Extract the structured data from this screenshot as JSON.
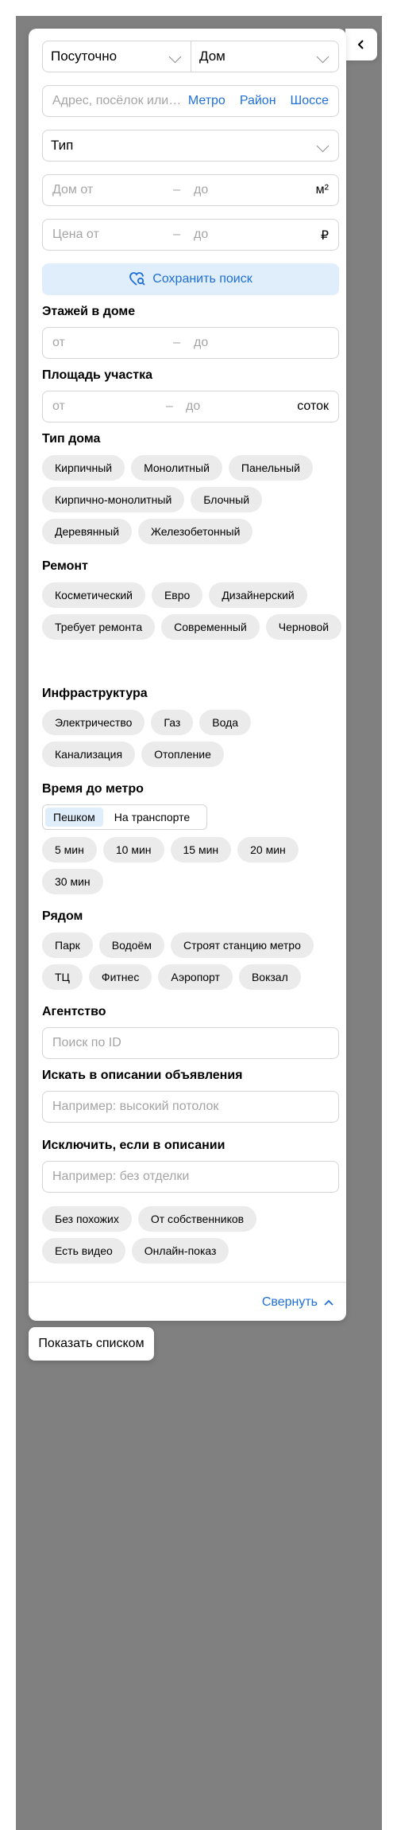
{
  "filters": {
    "deal_type": "Посуточно",
    "object_type": "Дом",
    "address_placeholder": "Адрес, посёлок или…",
    "address_links": [
      "Метро",
      "Район",
      "Шоссе"
    ],
    "type_select": "Тип",
    "house_area": {
      "from": "Дом от",
      "dash": "–",
      "to": "до",
      "unit": "м²"
    },
    "price": {
      "from": "Цена от",
      "dash": "–",
      "to": "до",
      "unit": "₽"
    },
    "save_search": "Сохранить поиск"
  },
  "floors": {
    "title": "Этажей в доме",
    "from": "от",
    "dash": "–",
    "to": "до"
  },
  "plot": {
    "title": "Площадь участка",
    "from": "от",
    "dash": "–",
    "to": "до",
    "unit": "соток"
  },
  "house_type": {
    "title": "Тип дома",
    "options": [
      "Кирпичный",
      "Монолитный",
      "Панельный",
      "Кирпично-монолитный",
      "Блочный",
      "Деревянный",
      "Железобетонный"
    ]
  },
  "renovation": {
    "title": "Ремонт",
    "options": [
      "Косметический",
      "Евро",
      "Дизайнерский",
      "Требует ремонта",
      "Современный",
      "Черновой"
    ]
  },
  "infrastructure": {
    "title": "Инфраструктура",
    "options": [
      "Электричество",
      "Газ",
      "Вода",
      "Канализация",
      "Отопление"
    ]
  },
  "metro_time": {
    "title": "Время до метро",
    "modes": [
      "Пешком",
      "На транспорте"
    ],
    "options": [
      "5 мин",
      "10 мин",
      "15 мин",
      "20 мин",
      "30 мин"
    ]
  },
  "nearby": {
    "title": "Рядом",
    "options": [
      "Парк",
      "Водоём",
      "Строят станцию метро",
      "ТЦ",
      "Фитнес",
      "Аэропорт",
      "Вокзал"
    ]
  },
  "agency": {
    "title": "Агентство",
    "placeholder": "Поиск по ID"
  },
  "search_desc": {
    "title": "Искать в описании объявления",
    "placeholder": "Например: высокий потолок"
  },
  "exclude_desc": {
    "title": "Исключить, если в описании",
    "placeholder": "Например: без отделки"
  },
  "extra": {
    "options": [
      "Без похожих",
      "От собственников",
      "Есть видео",
      "Онлайн-показ"
    ]
  },
  "footer": {
    "collapse": "Свернуть",
    "show_list": "Показать списком"
  },
  "colors": {
    "accent": "#1d6fd8",
    "chip_bg": "#ebebeb",
    "backdrop": "#808080"
  }
}
